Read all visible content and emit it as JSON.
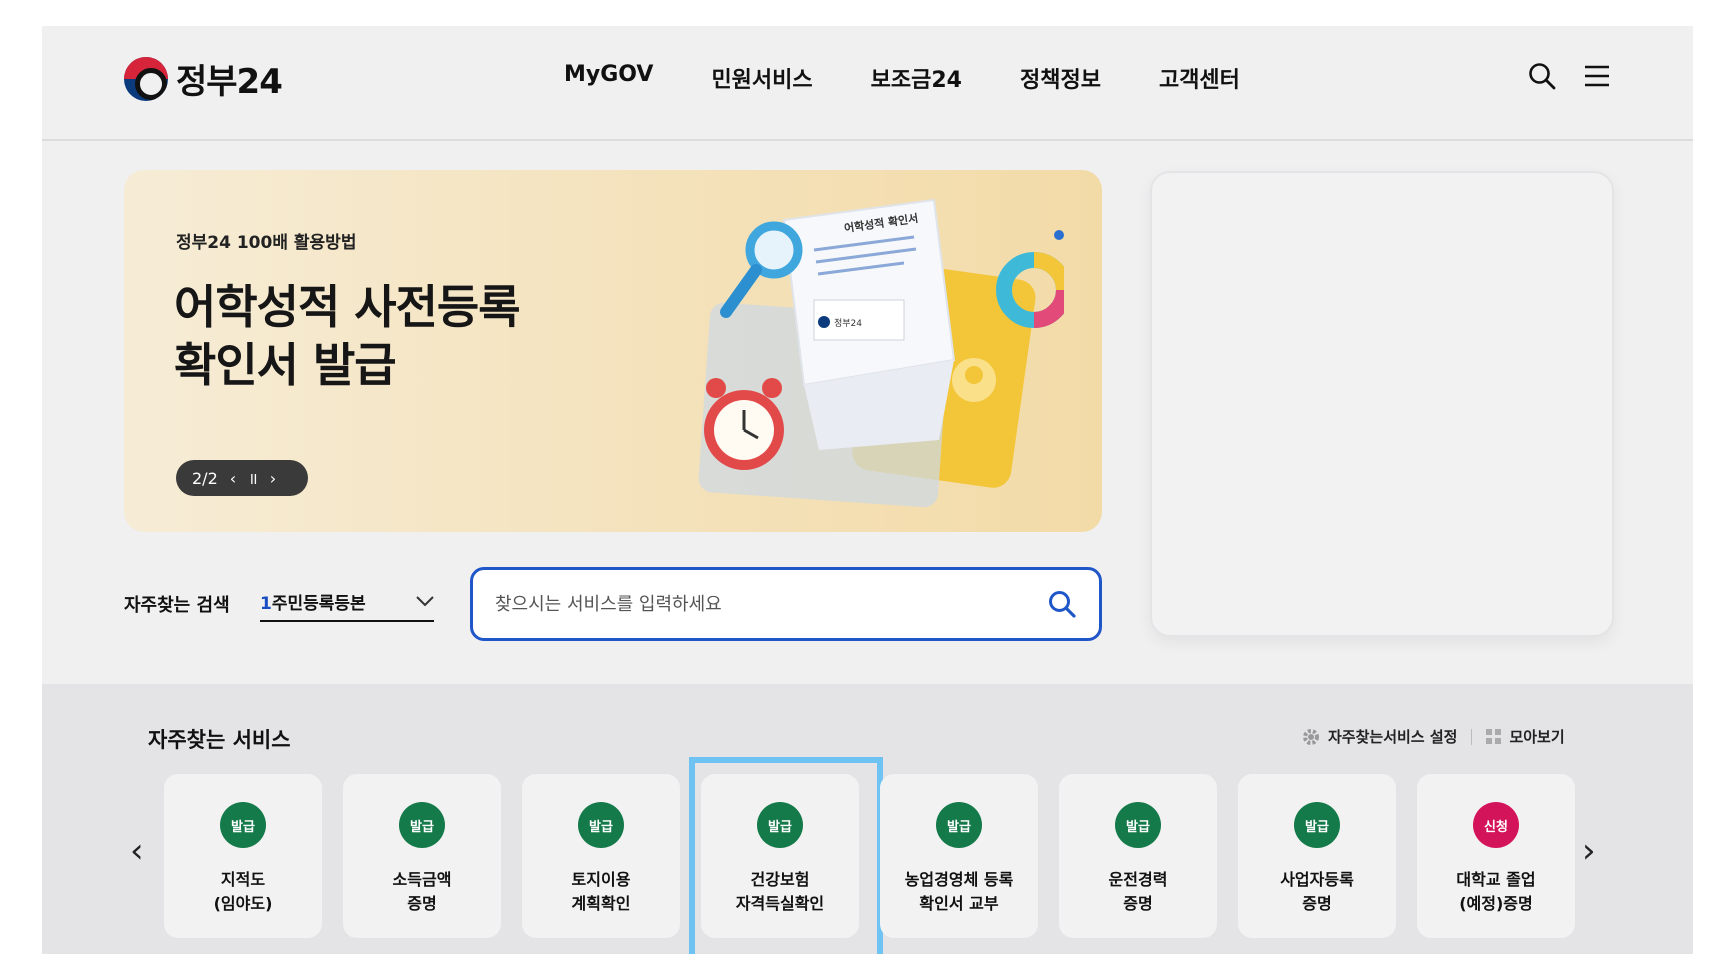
{
  "header": {
    "logo_text": "정부24",
    "nav": [
      "MyGOV",
      "민원서비스",
      "보조금24",
      "정책정보",
      "고객센터"
    ],
    "icons": [
      "search-icon",
      "hamburger-menu-icon"
    ]
  },
  "banner": {
    "subtitle": "정부24 100배 활용방법",
    "title_line1": "어학성적 사전등록",
    "title_line2": "확인서 발급",
    "pager_text": "2/2",
    "art_doc_text": "어학성적 확인서",
    "art_logo_text": "정부24"
  },
  "search": {
    "frequent_label": "자주찾는 검색",
    "frequent_number": "1",
    "frequent_value": "주민등록등본",
    "placeholder": "찾으시는 서비스를 입력하세요"
  },
  "services": {
    "title": "자주찾는 서비스",
    "settings_link": "자주찾는서비스 설정",
    "view_all_link": "모아보기",
    "items": [
      {
        "badge": "발급",
        "label": "지적도\n(임야도)",
        "color": "#147a4a"
      },
      {
        "badge": "발급",
        "label": "소득금액\n증명",
        "color": "#147a4a"
      },
      {
        "badge": "발급",
        "label": "토지이용\n계획확인",
        "color": "#147a4a"
      },
      {
        "badge": "발급",
        "label": "건강보험\n자격득실확인",
        "color": "#147a4a"
      },
      {
        "badge": "발급",
        "label": "농업경영체 등록\n확인서 교부",
        "color": "#147a4a"
      },
      {
        "badge": "발급",
        "label": "운전경력\n증명",
        "color": "#147a4a"
      },
      {
        "badge": "발급",
        "label": "사업자등록\n증명",
        "color": "#147a4a"
      },
      {
        "badge": "신청",
        "label": "대학교 졸업\n(예정)증명",
        "color": "#d4145a"
      }
    ]
  },
  "colors": {
    "accent_blue": "#1f57c8",
    "highlight": "#6ec3f2"
  }
}
